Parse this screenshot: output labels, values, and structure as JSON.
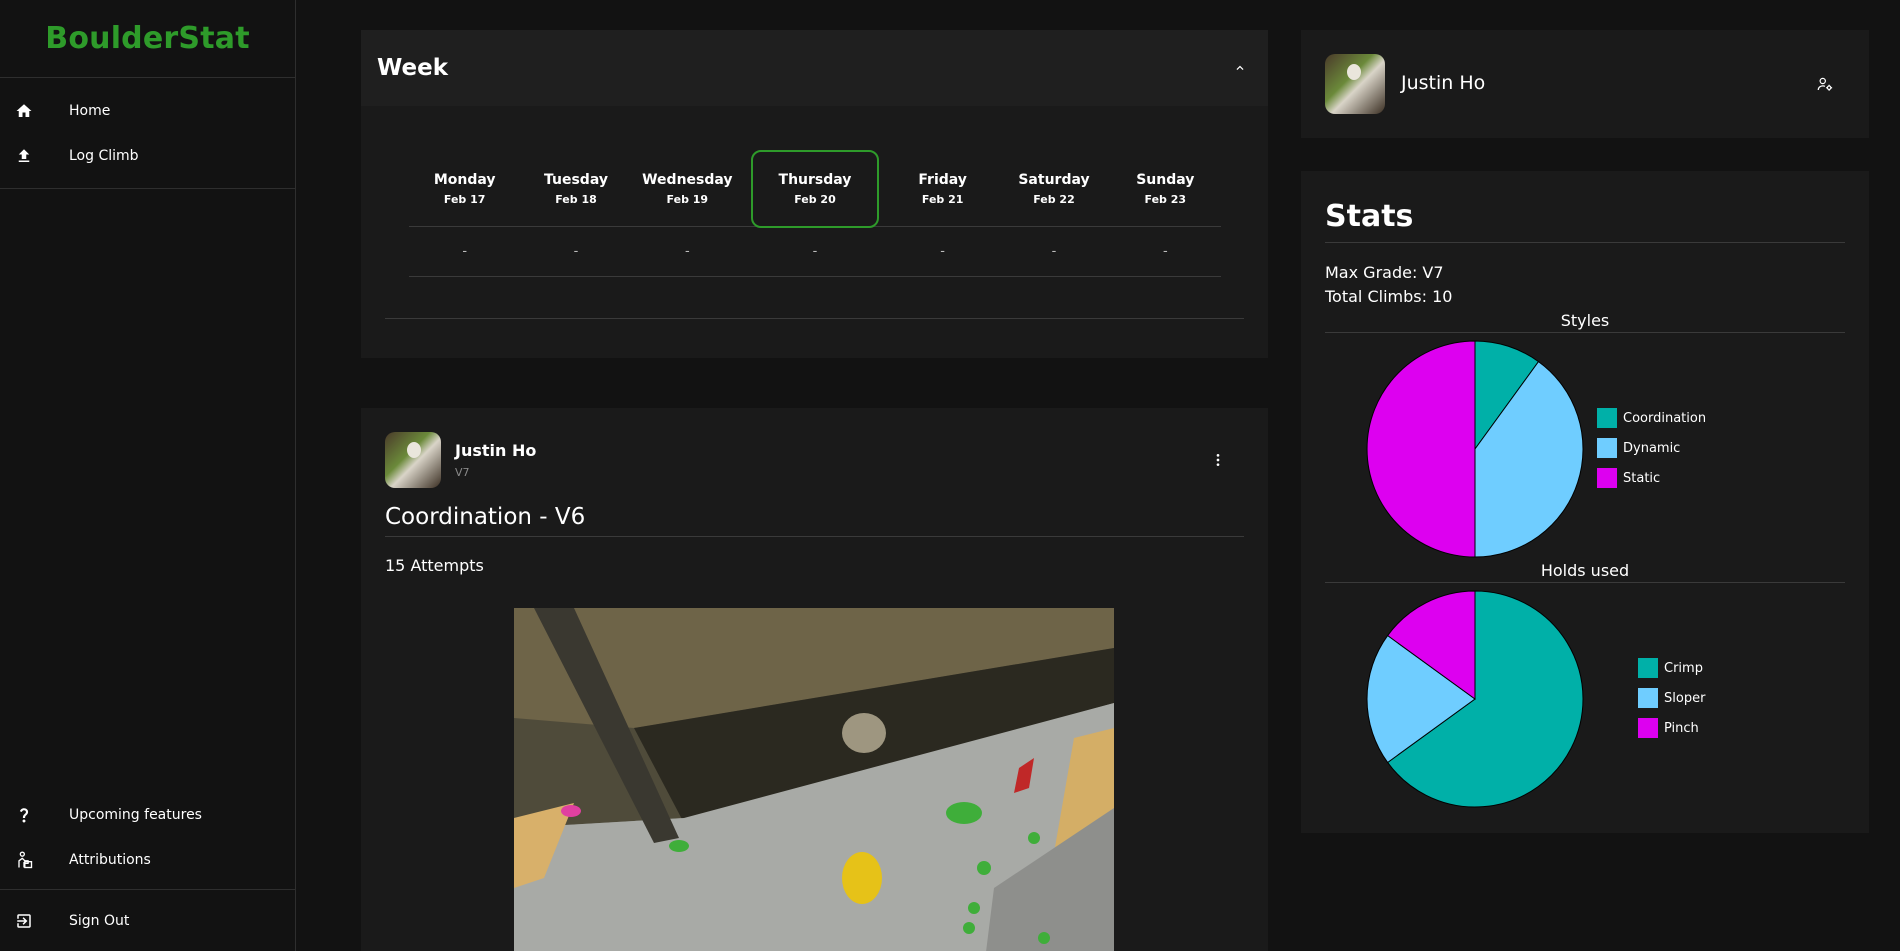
{
  "app": {
    "brand": "BoulderStat",
    "brand_color": "#2e9b2a"
  },
  "sidebar": {
    "items": [
      {
        "label": "Home",
        "icon": "home-icon"
      },
      {
        "label": "Log Climb",
        "icon": "upload-icon"
      }
    ],
    "bottom_items": [
      {
        "label": "Upcoming features",
        "icon": "question-icon"
      },
      {
        "label": "Attributions",
        "icon": "attribution-icon"
      }
    ],
    "signout": {
      "label": "Sign Out",
      "icon": "sign-out-icon"
    }
  },
  "week": {
    "title": "Week",
    "days": [
      {
        "name": "Monday",
        "date": "Feb 17",
        "value": "-"
      },
      {
        "name": "Tuesday",
        "date": "Feb 18",
        "value": "-"
      },
      {
        "name": "Wednesday",
        "date": "Feb 19",
        "value": "-"
      },
      {
        "name": "Thursday",
        "date": "Feb 20",
        "value": "-",
        "selected": true
      },
      {
        "name": "Friday",
        "date": "Feb 21",
        "value": "-"
      },
      {
        "name": "Saturday",
        "date": "Feb 22",
        "value": "-"
      },
      {
        "name": "Sunday",
        "date": "Feb 23",
        "value": "-"
      }
    ]
  },
  "climb": {
    "user": "Justin Ho",
    "user_grade": "V7",
    "title": "Coordination - V6",
    "attempts": "15 Attempts"
  },
  "profile": {
    "name": "Justin Ho"
  },
  "stats": {
    "title": "Stats",
    "max_grade": "Max Grade: V7",
    "total_climbs": "Total Climbs: 10",
    "styles_title": "Styles",
    "holds_title": "Holds used"
  },
  "chart_data": [
    {
      "type": "pie",
      "title": "Styles",
      "categories": [
        "Coordination",
        "Dynamic",
        "Static"
      ],
      "values": [
        1,
        4,
        5
      ],
      "colors": [
        "#00b0a8",
        "#6fcdff",
        "#dd00f0"
      ]
    },
    {
      "type": "pie",
      "title": "Holds used",
      "categories": [
        "Crimp",
        "Sloper",
        "Pinch"
      ],
      "values": [
        6.5,
        2,
        1.5
      ],
      "colors": [
        "#00b0a8",
        "#6fcdff",
        "#dd00f0"
      ]
    }
  ]
}
